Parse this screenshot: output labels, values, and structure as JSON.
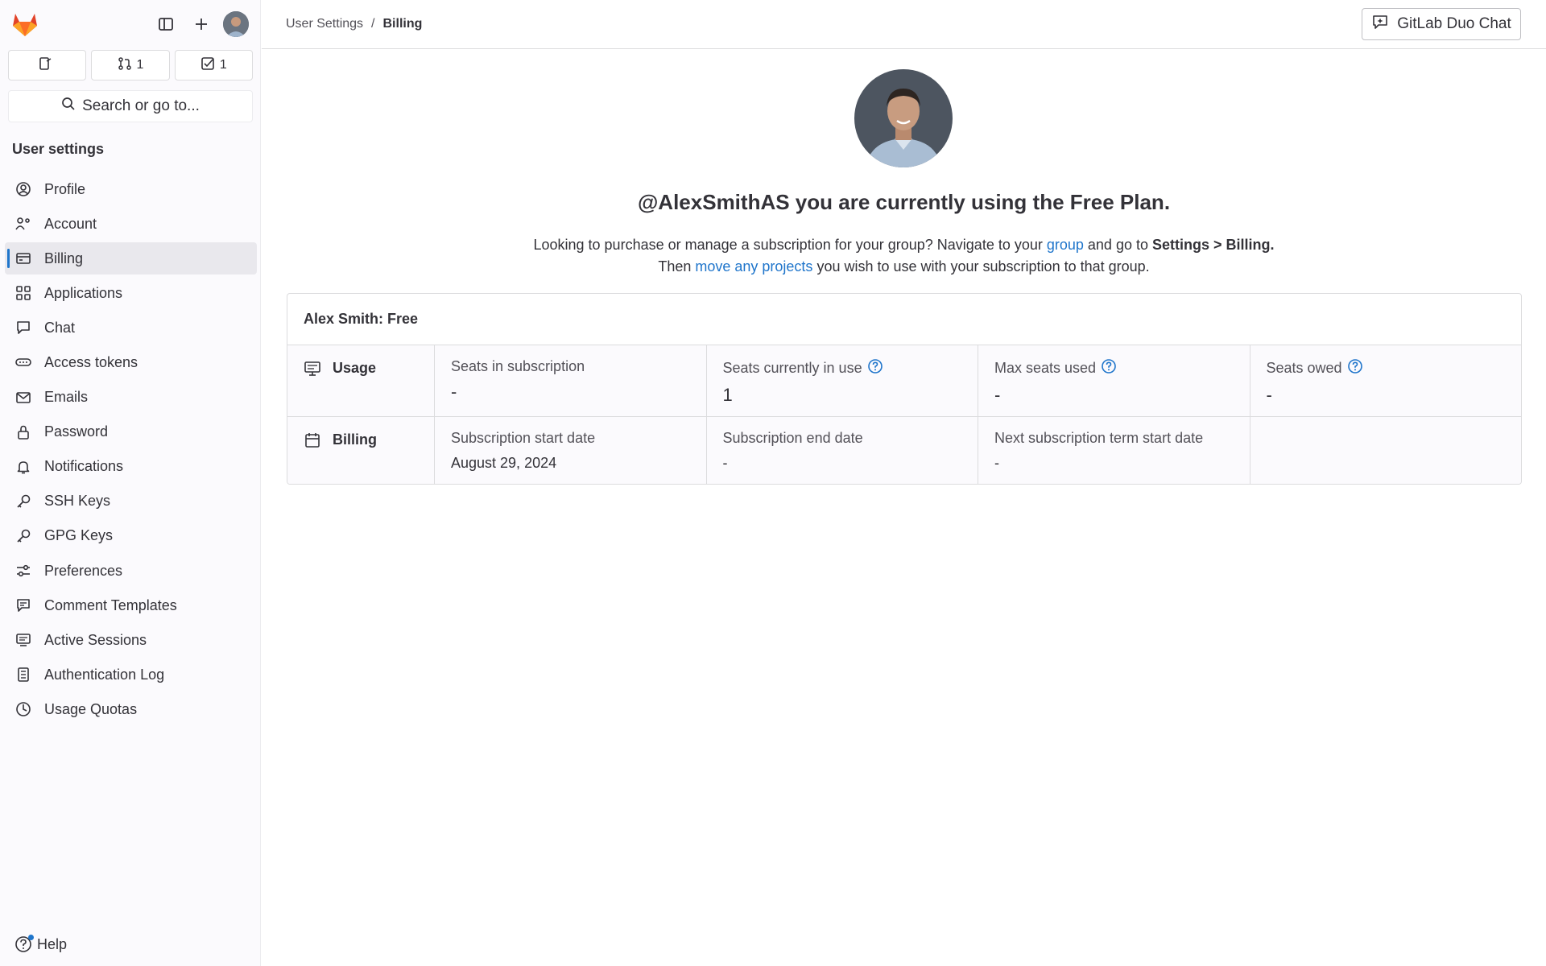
{
  "sidebar": {
    "counters": [
      {
        "name": "issues",
        "count": ""
      },
      {
        "name": "merge-requests",
        "count": "1"
      },
      {
        "name": "todos",
        "count": "1"
      }
    ],
    "search_label": "Search or go to...",
    "heading": "User settings",
    "items": [
      {
        "label": "Profile",
        "icon": "profile-icon"
      },
      {
        "label": "Account",
        "icon": "account-icon"
      },
      {
        "label": "Billing",
        "icon": "billing-icon",
        "active": true
      },
      {
        "label": "Applications",
        "icon": "applications-icon"
      },
      {
        "label": "Chat",
        "icon": "chat-icon"
      },
      {
        "label": "Access tokens",
        "icon": "token-icon"
      },
      {
        "label": "Emails",
        "icon": "mail-icon"
      },
      {
        "label": "Password",
        "icon": "lock-icon"
      },
      {
        "label": "Notifications",
        "icon": "bell-icon"
      },
      {
        "label": "SSH Keys",
        "icon": "key-icon"
      },
      {
        "label": "GPG Keys",
        "icon": "key-icon"
      },
      {
        "label": "Preferences",
        "icon": "preferences-icon"
      },
      {
        "label": "Comment Templates",
        "icon": "comment-icon"
      },
      {
        "label": "Active Sessions",
        "icon": "monitor-icon"
      },
      {
        "label": "Authentication Log",
        "icon": "log-icon"
      },
      {
        "label": "Usage Quotas",
        "icon": "quota-icon"
      }
    ],
    "help_label": "Help"
  },
  "topbar": {
    "breadcrumb": [
      "User Settings",
      "Billing"
    ],
    "breadcrumb_separator": "/",
    "duo_label": "GitLab Duo Chat"
  },
  "main": {
    "title": "@AlexSmithAS you are currently using the Free Plan.",
    "desc_line1_a": "Looking to purchase or manage a subscription for your group? Navigate to your ",
    "desc_line1_link": "group",
    "desc_line1_b": " and go to ",
    "desc_line1_bold": "Settings > Billing.",
    "desc_line2_a": "Then ",
    "desc_line2_link": "move any projects",
    "desc_line2_b": " you wish to use with your subscription to that group.",
    "card": {
      "header": "Alex Smith: Free",
      "usage": {
        "label": "Usage",
        "cells": [
          {
            "label": "Seats in subscription",
            "value": "-",
            "help": false
          },
          {
            "label": "Seats currently in use",
            "value": "1",
            "help": true
          },
          {
            "label": "Max seats used",
            "value": "-",
            "help": true
          },
          {
            "label": "Seats owed",
            "value": "-",
            "help": true
          }
        ]
      },
      "billing": {
        "label": "Billing",
        "cells": [
          {
            "label": "Subscription start date",
            "value": "August 29, 2024"
          },
          {
            "label": "Subscription end date",
            "value": "-"
          },
          {
            "label": "Next subscription term start date",
            "value": "-"
          },
          {
            "label": "",
            "value": ""
          }
        ]
      }
    }
  },
  "colors": {
    "link": "#1f75cb",
    "active_indicator": "#1f75cb",
    "gitlab_orange": "#fc6d26"
  }
}
